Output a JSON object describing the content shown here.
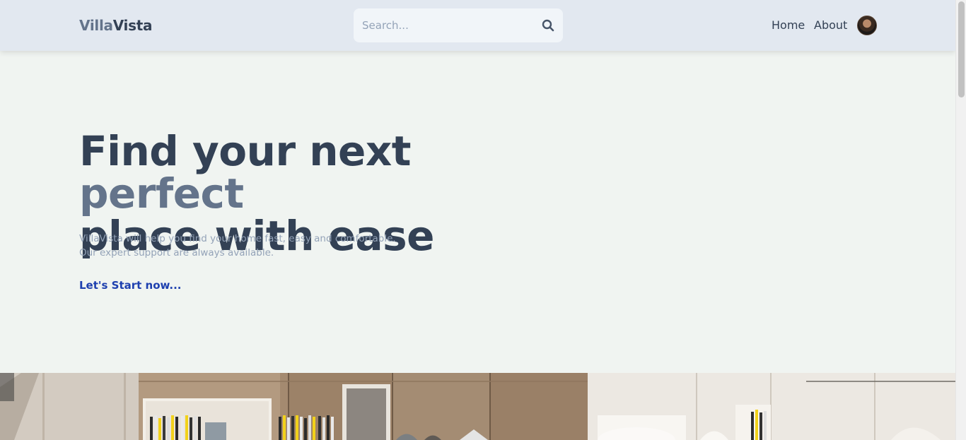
{
  "header": {
    "logo_part1": "Villa",
    "logo_part2": "Vista",
    "search": {
      "placeholder": "Search...",
      "value": ""
    },
    "nav": {
      "home": "Home",
      "about": "About"
    }
  },
  "hero": {
    "title_start": "Find your next ",
    "title_accent": "perfect",
    "title_end": "place with ease",
    "subtitle_line1": "VillaVista will help you find your home fast, easy and comfortable.",
    "subtitle_line2": "Our expert support are always available.",
    "cta": "Let's Start now..."
  },
  "colors": {
    "header_bg": "#e2e8f0",
    "page_bg": "#f0f4f1",
    "title": "#334155",
    "accent": "#64748b",
    "cta": "#1e40af"
  },
  "icons": {
    "search": "search-icon",
    "avatar": "avatar"
  }
}
